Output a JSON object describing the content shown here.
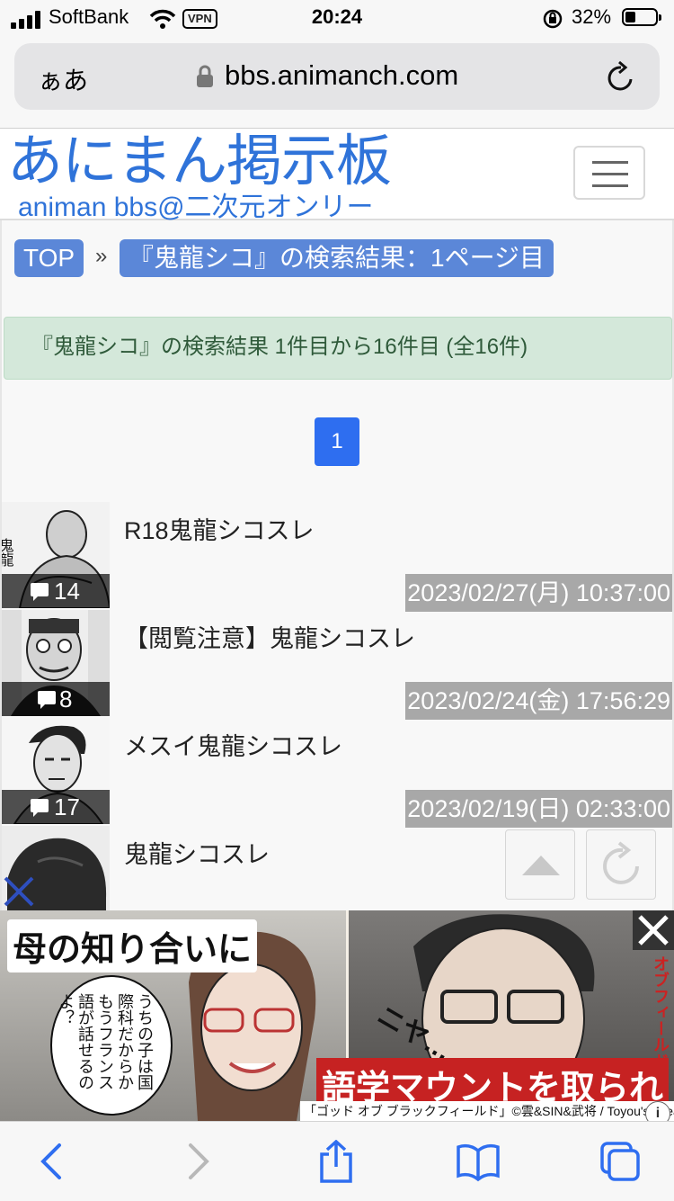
{
  "status_bar": {
    "carrier": "SoftBank",
    "vpn": "VPN",
    "time": "20:24",
    "battery": "32%",
    "icons": [
      "signal-icon",
      "wifi-icon",
      "orientation-lock-icon",
      "battery-icon"
    ]
  },
  "browser": {
    "text_size_label": "ぁあ",
    "domain": "bbs.animanch.com"
  },
  "site": {
    "logo_title": "あにまん掲示板",
    "logo_subtitle": "animan bbs@二次元オンリー",
    "brand_color": "#2f73d9"
  },
  "breadcrumb": {
    "home": "TOP",
    "separator": "»",
    "current": "『鬼龍シコ』の検索結果：1ページ目"
  },
  "search": {
    "summary": "『鬼龍シコ』の検索結果 1件目から16件目 (全16件)"
  },
  "pagination": {
    "current_page": "1"
  },
  "threads": [
    {
      "title": "R18鬼龍シコスレ",
      "comments": "14",
      "date": "2023/02/27(月) 10:37:00"
    },
    {
      "title": "【閲覧注意】鬼龍シコスレ",
      "comments": "8",
      "date": "2023/02/24(金) 17:56:29"
    },
    {
      "title": "メスイ鬼龍シコスレ",
      "comments": "17",
      "date": "2023/02/19(日) 02:33:00"
    },
    {
      "title": "鬼龍シコスレ",
      "comments": "",
      "date": ""
    }
  ],
  "ad": {
    "headline": "母の知り合いに",
    "speech": "うちの子は国際科だからかもうフランス語が話せるのよ？",
    "sfx": "ニヤ…",
    "tagline": "語学マウントを取られ",
    "credit": "「ゴッド オブ ブラックフィールド」©雲&SIN&武将 / Toyou's Dream",
    "side_text": "オブフィールド",
    "info": "i"
  }
}
